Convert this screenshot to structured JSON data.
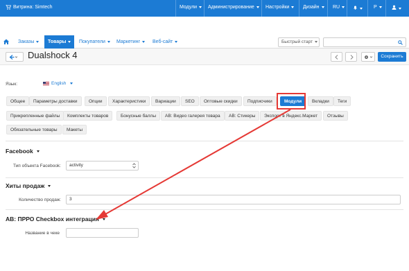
{
  "topbar": {
    "store_label": "Витрина: Simtech",
    "menus": [
      "Модули",
      "Администрирование",
      "Настройки",
      "Дизайн"
    ],
    "lang": "RU",
    "currency": "Р"
  },
  "nav": {
    "items": [
      "Заказы",
      "Товары",
      "Покупатели",
      "Маркетинг",
      "Веб-сайт"
    ],
    "quick_start": "Быстрый старт"
  },
  "page": {
    "title": "Dualshock 4",
    "save_label": "Сохранить"
  },
  "language": {
    "label": "Язык:",
    "value": "English"
  },
  "tabs": {
    "row1": [
      "Общее",
      "Параметры доставки",
      "Опции",
      "Характеристики",
      "Вариации",
      "SEO",
      "Оптовые скидки",
      "Подписчики",
      "Модули",
      "Вкладки",
      "Теги"
    ],
    "row2": [
      "Прикрепленные файлы",
      "Комплекты товаров",
      "Бонусные баллы",
      "AB: Видео галерея товара",
      "AB: Стикеры",
      "Экспорт в Яндекс.Маркет",
      "Отзывы"
    ],
    "row3": [
      "Обязательные товары",
      "Макеты"
    ],
    "active": "Модули"
  },
  "sections": {
    "facebook": {
      "title": "Facebook",
      "field_label": "Тип объекта Facebook:",
      "field_value": "activity"
    },
    "hits": {
      "title": "Хиты продаж",
      "field_label": "Количество продаж:",
      "field_value": "3"
    },
    "checkbox": {
      "title": "AB: ПРРО Checkbox интеграция",
      "field_label": "Название в чеке",
      "field_value": ""
    }
  },
  "colors": {
    "primary": "#1c7bd4",
    "annotation": "#e53935"
  }
}
